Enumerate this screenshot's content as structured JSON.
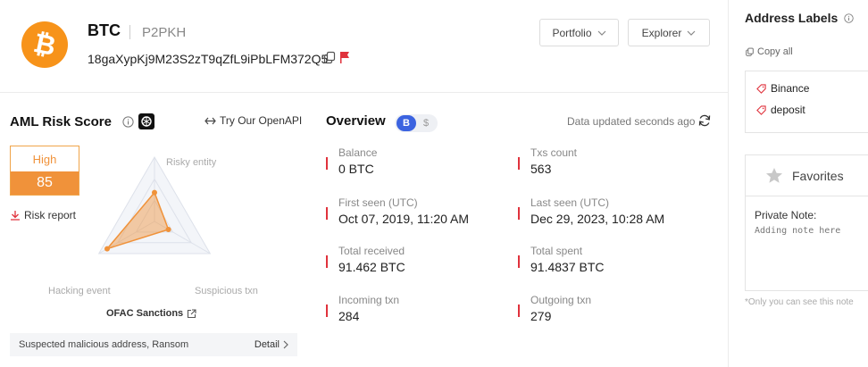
{
  "header": {
    "coin_symbol": "BTC",
    "coin_type": "P2PKH",
    "address": "18gaXypKj9M23S2zT9qZfL9iPbLFM372Q5",
    "portfolio_label": "Portfolio",
    "explorer_label": "Explorer",
    "brand_color": "#f7931a"
  },
  "aml": {
    "title": "AML Risk Score",
    "openapi_label": "Try Our OpenAPI",
    "risk_level": "High",
    "risk_score": "85",
    "risk_report_label": "Risk report",
    "radar": {
      "axes": [
        "Risky entity",
        "Hacking event",
        "Suspicious txn"
      ],
      "values": [
        0.45,
        0.85,
        0.25
      ],
      "fill_color": "#f0923a"
    },
    "ofac_label": "OFAC Sanctions",
    "suspected_text": "Suspected malicious address, Ransom",
    "detail_label": "Detail"
  },
  "overview": {
    "title": "Overview",
    "toggle_btc": "B",
    "toggle_usd": "$",
    "updated_text": "Data updated seconds ago",
    "stats": [
      {
        "label": "Balance",
        "value": "0 BTC"
      },
      {
        "label": "Txs count",
        "value": "563"
      },
      {
        "label": "First seen (UTC)",
        "value": "Oct 07, 2019, 11:20 AM"
      },
      {
        "label": "Last seen (UTC)",
        "value": "Dec 29, 2023, 10:28 AM"
      },
      {
        "label": "Total received",
        "value": "91.462 BTC"
      },
      {
        "label": "Total spent",
        "value": "91.4837 BTC"
      },
      {
        "label": "Incoming txn",
        "value": "284"
      },
      {
        "label": "Outgoing txn",
        "value": "279"
      }
    ]
  },
  "sidebar": {
    "address_labels_title": "Address Labels",
    "copy_all_label": "Copy all",
    "tags": [
      "Binance",
      "deposit"
    ],
    "favorites_label": "Favorites",
    "private_note_label": "Private Note:",
    "note_placeholder": "Adding note here",
    "only_you_text": "*Only you can see this note"
  }
}
